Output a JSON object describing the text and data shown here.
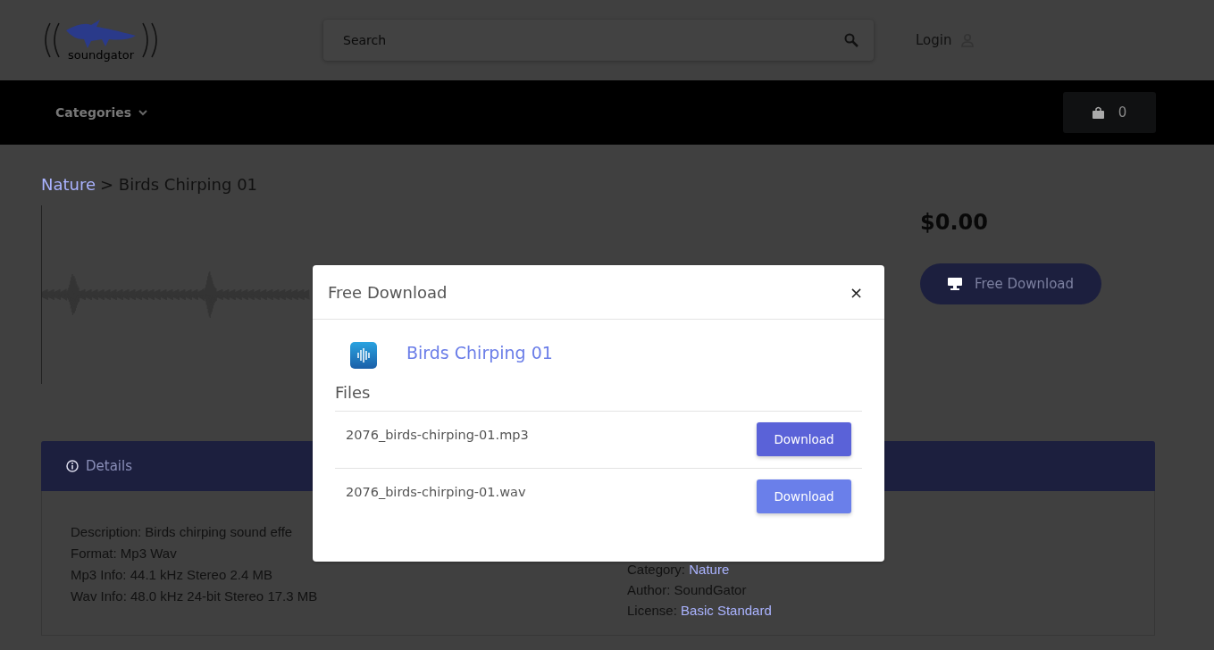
{
  "header": {
    "logo_text": "soundgator",
    "search": {
      "placeholder": "Search"
    },
    "login": "Login"
  },
  "nav": {
    "categories": "Categories",
    "cart_count": "0"
  },
  "breadcrumb": {
    "link": "Nature",
    "current": "> Birds Chirping 01"
  },
  "product": {
    "price": "$0.00",
    "button": "Free Download"
  },
  "details": {
    "tab": "Details",
    "left": [
      "Description: Birds chirping sound effe",
      "Format: Mp3 Wav",
      "Mp3 Info: 44.1 kHz Stereo 2.4 MB",
      "Wav Info: 48.0 kHz 24-bit Stereo 17.3 MB"
    ],
    "right": [
      {
        "label": "Category:",
        "value": "Nature",
        "kind": "link"
      },
      {
        "label": "Author:",
        "value": "SoundGator",
        "kind": "text"
      },
      {
        "label": "License:",
        "value": "Basic Standard",
        "kind": "link"
      }
    ]
  },
  "modal": {
    "title": "Free Download",
    "close": "×",
    "sound_title": "Birds Chirping 01",
    "files_heading": "Files",
    "files": [
      {
        "name": "2076_birds-chirping-01.mp3",
        "button": "Download",
        "highlighted": false
      },
      {
        "name": "2076_birds-chirping-01.wav",
        "button": "Download",
        "highlighted": true
      }
    ]
  }
}
